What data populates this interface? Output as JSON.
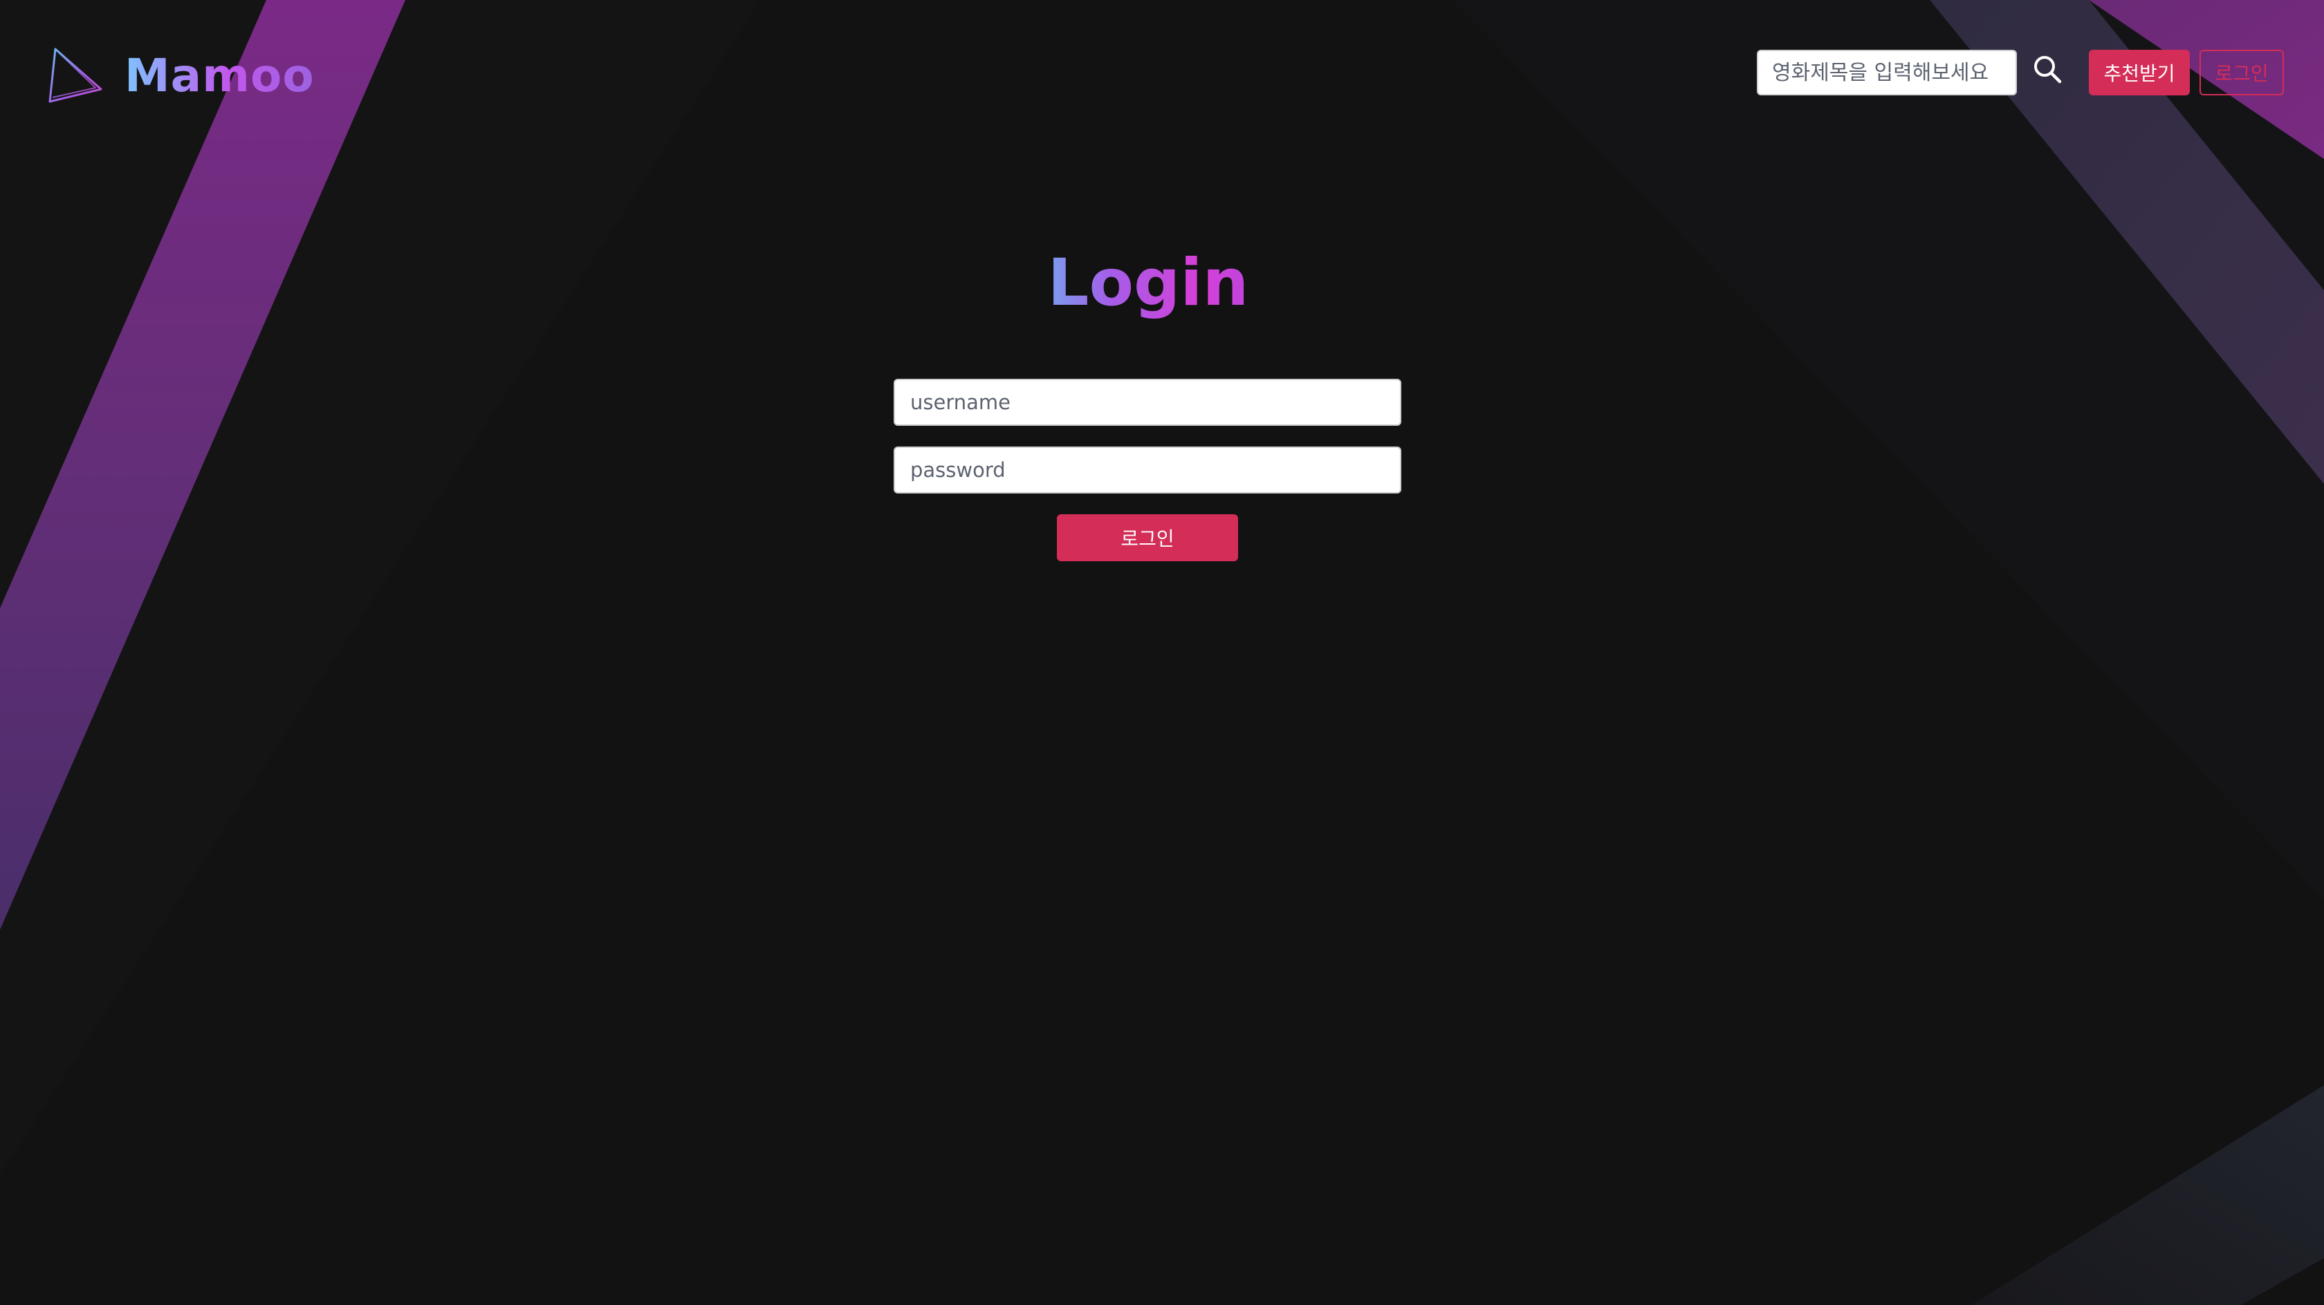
{
  "brand": {
    "name": "Mamoo",
    "logo_icon": "play-triangle-icon"
  },
  "navbar": {
    "search": {
      "placeholder": "영화제목을 입력해보세요",
      "icon": "search-icon"
    },
    "recommend_label": "추천받기",
    "login_label": "로그인"
  },
  "main": {
    "title": "Login",
    "username_placeholder": "username",
    "password_placeholder": "password",
    "submit_label": "로그인"
  },
  "colors": {
    "background": "#121212",
    "accent": "#d42d58",
    "brand_gradient_start": "#7fc3ff",
    "brand_gradient_end": "#c257ec"
  }
}
